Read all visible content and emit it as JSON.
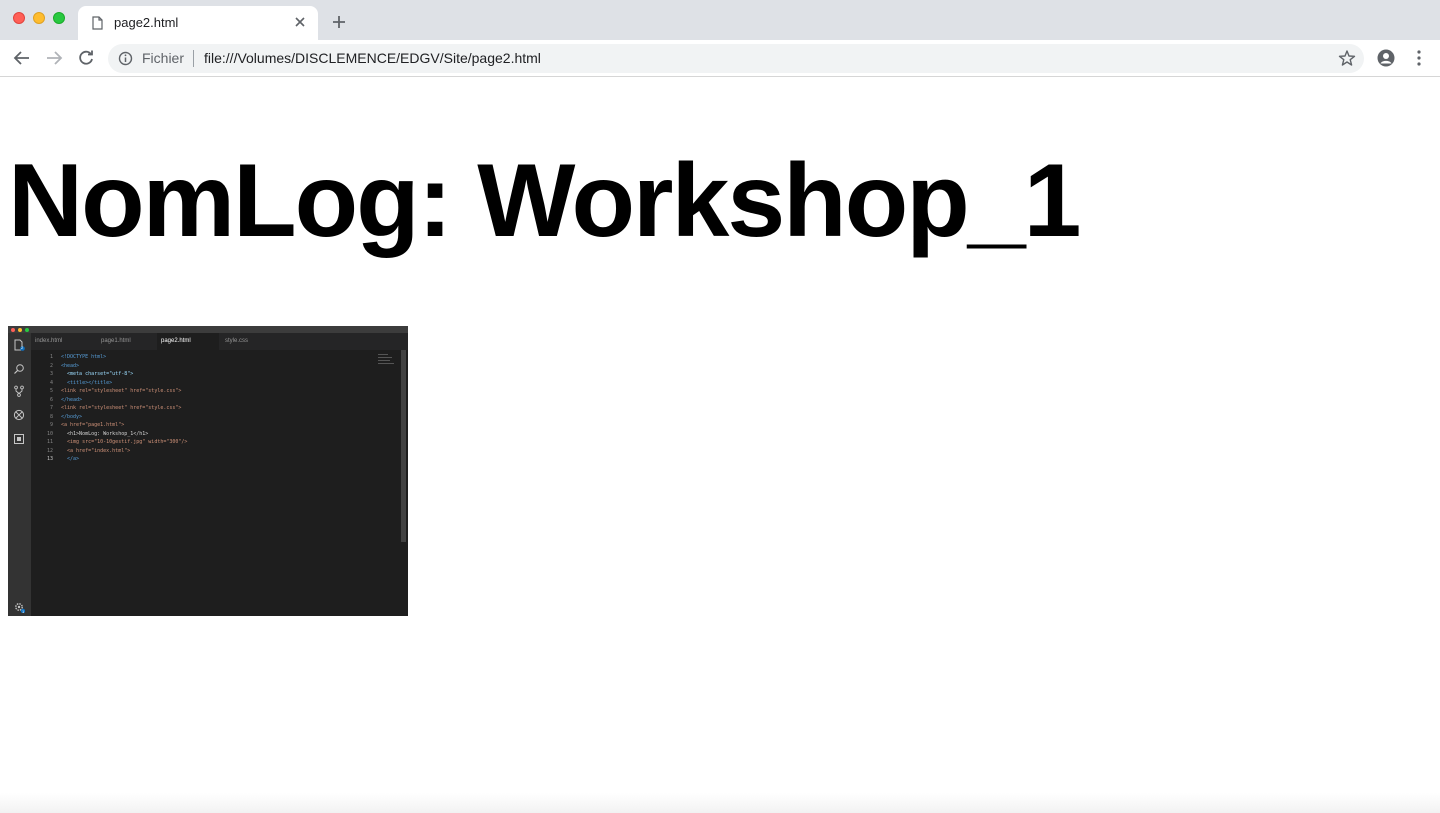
{
  "browser": {
    "tab_title": "page2.html",
    "address": {
      "scheme_label": "Fichier",
      "url": "file:///Volumes/DISCLEMENCE/EDGV/Site/page2.html"
    }
  },
  "page": {
    "heading": "NomLog: Workshop_1"
  },
  "embedded_image": {
    "tabs": [
      "index.html",
      "page1.html",
      "page2.html",
      "style.css"
    ],
    "line_numbers": [
      "1",
      "2",
      "3",
      "4",
      "5",
      "6",
      "7",
      "8",
      "9",
      "10",
      "11",
      "12",
      "13"
    ],
    "code_lines": [
      "<!DOCTYPE html>",
      "<head>",
      "  <meta charset=\"utf-8\">",
      "  <title></title>",
      "<link rel=\"stylesheet\" href=\"style.css\">",
      "</head>",
      "<link rel=\"stylesheet\" href=\"style.css\">",
      "</body>",
      "<a href=\"page1.html\">",
      "  <h1>NomLog: Workshop_1</h1>",
      "  <img src=\"10-10gestif.jpg\" width=\"300\"/>",
      "  <a href=\"index.html\">",
      "  </a>"
    ],
    "badge_count": "2",
    "gear_badge": "1"
  }
}
